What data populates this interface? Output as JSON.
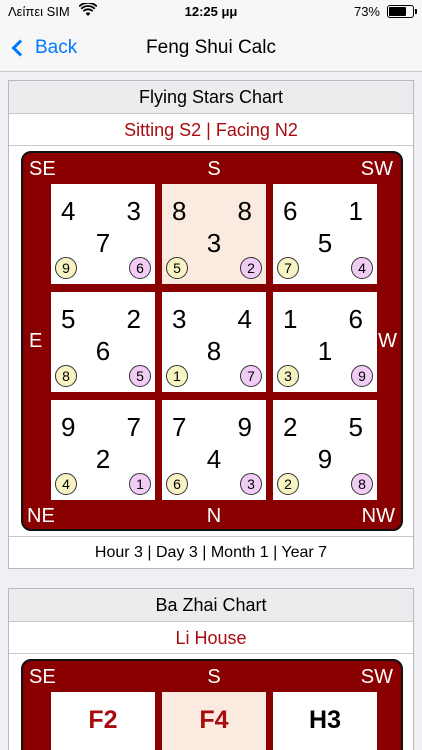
{
  "status": {
    "carrier": "Λείπει SIM",
    "time": "12:25 μμ",
    "battery": "73%",
    "battery_level": 0.73
  },
  "nav": {
    "back_label": "Back",
    "title": "Feng Shui Calc"
  },
  "flying": {
    "title": "Flying Stars Chart",
    "subtitle": "Sitting S2 | Facing N2",
    "dirs": {
      "se": "SE",
      "s": "S",
      "sw": "SW",
      "e": "E",
      "w": "W",
      "ne": "NE",
      "n": "N",
      "nw": "NW"
    },
    "cells": [
      {
        "tl": "4",
        "tr": "3",
        "c": "7",
        "y": "9",
        "p": "6"
      },
      {
        "tl": "8",
        "tr": "8",
        "c": "3",
        "y": "5",
        "p": "2"
      },
      {
        "tl": "6",
        "tr": "1",
        "c": "5",
        "y": "7",
        "p": "4"
      },
      {
        "tl": "5",
        "tr": "2",
        "c": "6",
        "y": "8",
        "p": "5"
      },
      {
        "tl": "3",
        "tr": "4",
        "c": "8",
        "y": "1",
        "p": "7"
      },
      {
        "tl": "1",
        "tr": "6",
        "c": "1",
        "y": "3",
        "p": "9"
      },
      {
        "tl": "9",
        "tr": "7",
        "c": "2",
        "y": "4",
        "p": "1"
      },
      {
        "tl": "7",
        "tr": "9",
        "c": "4",
        "y": "6",
        "p": "3"
      },
      {
        "tl": "2",
        "tr": "5",
        "c": "9",
        "y": "2",
        "p": "8"
      }
    ],
    "footer": "Hour 3 | Day 3 | Month 1 | Year 7"
  },
  "bazhai": {
    "title": "Ba Zhai Chart",
    "subtitle": "Li House",
    "dirs": {
      "se": "SE",
      "s": "S",
      "sw": "SW"
    },
    "cells": [
      "F2",
      "F4",
      "H3"
    ]
  },
  "colors": {
    "accent": "#007aff",
    "board": "#8a0000",
    "red_text": "#a80c10",
    "highlight": "#fbeadf"
  }
}
